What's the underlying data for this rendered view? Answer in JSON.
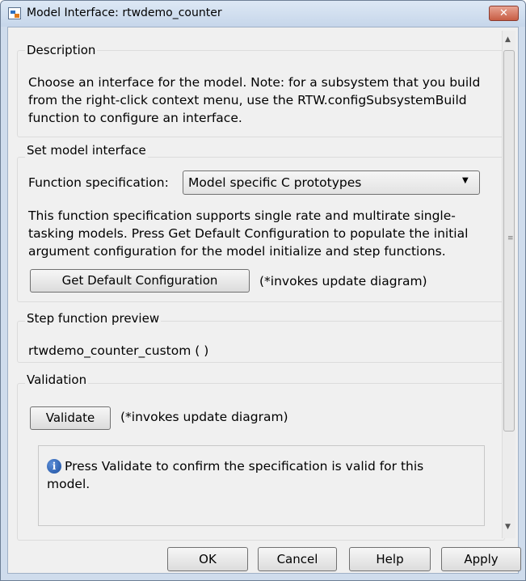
{
  "window": {
    "title": "Model Interface: rtwdemo_counter",
    "close_symbol": "✕"
  },
  "description": {
    "label": "Description",
    "text": "Choose an interface for the model. Note: for a subsystem that you build from the right-click context menu, use the RTW.configSubsystemBuild function to configure an interface."
  },
  "set_model_interface": {
    "label": "Set model interface",
    "function_spec_label": "Function specification:",
    "function_spec_value": "Model specific C prototypes",
    "info_text": "This function specification supports single rate and multirate single-tasking models.  Press Get Default Configuration to populate the initial argument configuration for the model initialize and step functions.",
    "get_default_button": "Get Default Configuration",
    "get_default_note": "(*invokes update diagram)"
  },
  "step_preview": {
    "label": "Step function preview",
    "text": "rtwdemo_counter_custom ( )"
  },
  "validation": {
    "label": "Validation",
    "validate_button": "Validate",
    "validate_note": "(*invokes update diagram)",
    "message": "Press Validate to confirm the specification is valid for this model."
  },
  "footer": {
    "ok": "OK",
    "cancel": "Cancel",
    "help": "Help",
    "apply": "Apply"
  },
  "icons": {
    "info": "i",
    "dropdown": "▼",
    "scroll_up": "▲",
    "scroll_down": "▼",
    "grip": "≡"
  }
}
